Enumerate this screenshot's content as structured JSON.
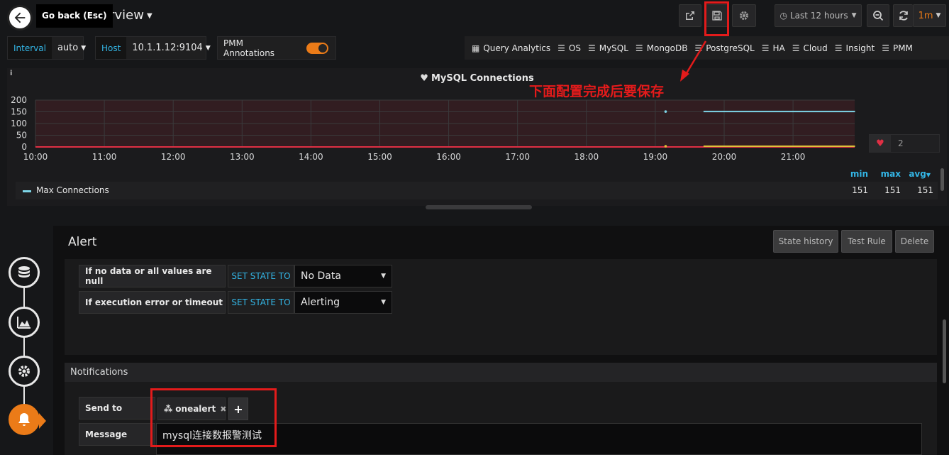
{
  "header": {
    "back_tooltip": "Go back (Esc)",
    "dashboard_title_partial": "erview",
    "time_range": "Last 12 hours",
    "refresh_interval": "1m"
  },
  "variables": {
    "interval_label": "Interval",
    "interval_value": "auto",
    "host_label": "Host",
    "host_value": "10.1.1.12:9104",
    "annotations_label": "PMM Annotations",
    "annotations_enabled": true
  },
  "links": [
    "Query Analytics",
    "OS",
    "MySQL",
    "MongoDB",
    "PostgreSQL",
    "HA",
    "Cloud",
    "Insight",
    "PMM"
  ],
  "panel": {
    "title": "MySQL Connections",
    "heart_value": "2",
    "legend": {
      "headers": [
        "min",
        "max",
        "avg"
      ],
      "series": [
        {
          "name": "Max Connections",
          "min": "151",
          "max": "151",
          "avg": "151"
        }
      ]
    }
  },
  "annotation_text": "下面配置完成后要保存",
  "chart_data": {
    "type": "line",
    "title": "MySQL Connections",
    "x_ticks": [
      "10:00",
      "11:00",
      "12:00",
      "13:00",
      "14:00",
      "15:00",
      "16:00",
      "17:00",
      "18:00",
      "19:00",
      "20:00",
      "21:00"
    ],
    "y_ticks": [
      "200",
      "150",
      "100",
      "50",
      "0"
    ],
    "ylim": [
      0,
      200
    ],
    "series": [
      {
        "name": "Max Connections",
        "color": "#7ed6e8",
        "points": [
          [
            19.15,
            151
          ],
          [
            19.7,
            151
          ],
          [
            21.9,
            151
          ]
        ]
      },
      {
        "name": "",
        "color": "#e0c13a",
        "points": [
          [
            19.15,
            3
          ],
          [
            19.7,
            3
          ],
          [
            21.9,
            3
          ]
        ]
      }
    ],
    "alert_threshold": 0,
    "threshold_color": "#e02f44"
  },
  "alert": {
    "title": "Alert",
    "buttons": [
      "State history",
      "Test Rule",
      "Delete"
    ],
    "conditions": [
      {
        "label": "If no data or all values are null",
        "set_label": "SET STATE TO",
        "value": "No Data"
      },
      {
        "label": "If execution error or timeout",
        "set_label": "SET STATE TO",
        "value": "Alerting"
      }
    ],
    "notifications_title": "Notifications",
    "send_to_label": "Send to",
    "send_to_tag": "onealert",
    "message_label": "Message",
    "message_value": "mysql连接数报警测试"
  }
}
